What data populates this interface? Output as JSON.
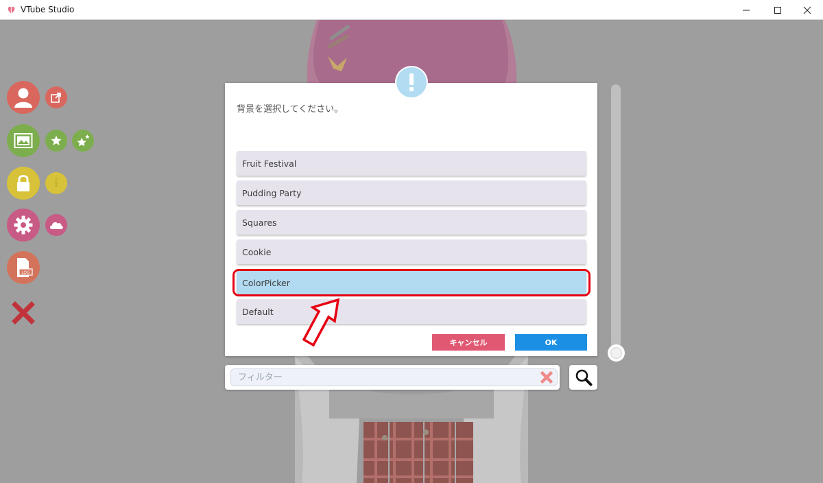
{
  "window": {
    "title": "VTube Studio",
    "app_icon": "vtube-studio-logo",
    "controls": [
      "minimize-icon",
      "maximize-icon",
      "close-icon"
    ]
  },
  "sidebar": {
    "buttons": [
      {
        "name": "model-button",
        "icon": "person-icon",
        "color": "#d9675e"
      },
      {
        "name": "model-share-button",
        "icon": "share-icon",
        "color": "#d9675e"
      },
      {
        "name": "background-button",
        "icon": "picture-icon",
        "color": "#7dae4e"
      },
      {
        "name": "favorite-button",
        "icon": "star-icon",
        "color": "#7dae4e"
      },
      {
        "name": "stars-button",
        "icon": "stars-icon",
        "color": "#7dae4e"
      },
      {
        "name": "lock-button",
        "icon": "lock-icon",
        "color": "#d7c23a"
      },
      {
        "name": "info-button",
        "icon": "info-icon",
        "color": "#d7c23a"
      },
      {
        "name": "settings-button",
        "icon": "gear-icon",
        "color": "#c85a86"
      },
      {
        "name": "cloud-button",
        "icon": "cloud-icon",
        "color": "#c85a86"
      },
      {
        "name": "log-button",
        "icon": "log-file-icon",
        "color": "#d4735b"
      },
      {
        "name": "hide-ui-button",
        "icon": "close-x-icon",
        "color": "#c0333b"
      }
    ],
    "log_icon_label": "LOG"
  },
  "dialog": {
    "icon": "exclamation-icon",
    "message": "背景を選択してください。",
    "items": [
      {
        "label": "Fruit Festival",
        "selected": false
      },
      {
        "label": "Pudding Party",
        "selected": false
      },
      {
        "label": "Squares",
        "selected": false
      },
      {
        "label": "Cookie",
        "selected": false
      },
      {
        "label": "ColorPicker",
        "selected": true
      },
      {
        "label": "Default",
        "selected": false
      }
    ],
    "cancel_label": "キャンセル",
    "ok_label": "OK",
    "accent_selected": "#b2daf0",
    "annotation_color": "#e60012"
  },
  "filter": {
    "placeholder": "フィルター",
    "value": "",
    "clear_icon": "clear-x-icon",
    "search_icon": "magnifier-icon"
  },
  "zoom_slider": {
    "value": 0
  }
}
